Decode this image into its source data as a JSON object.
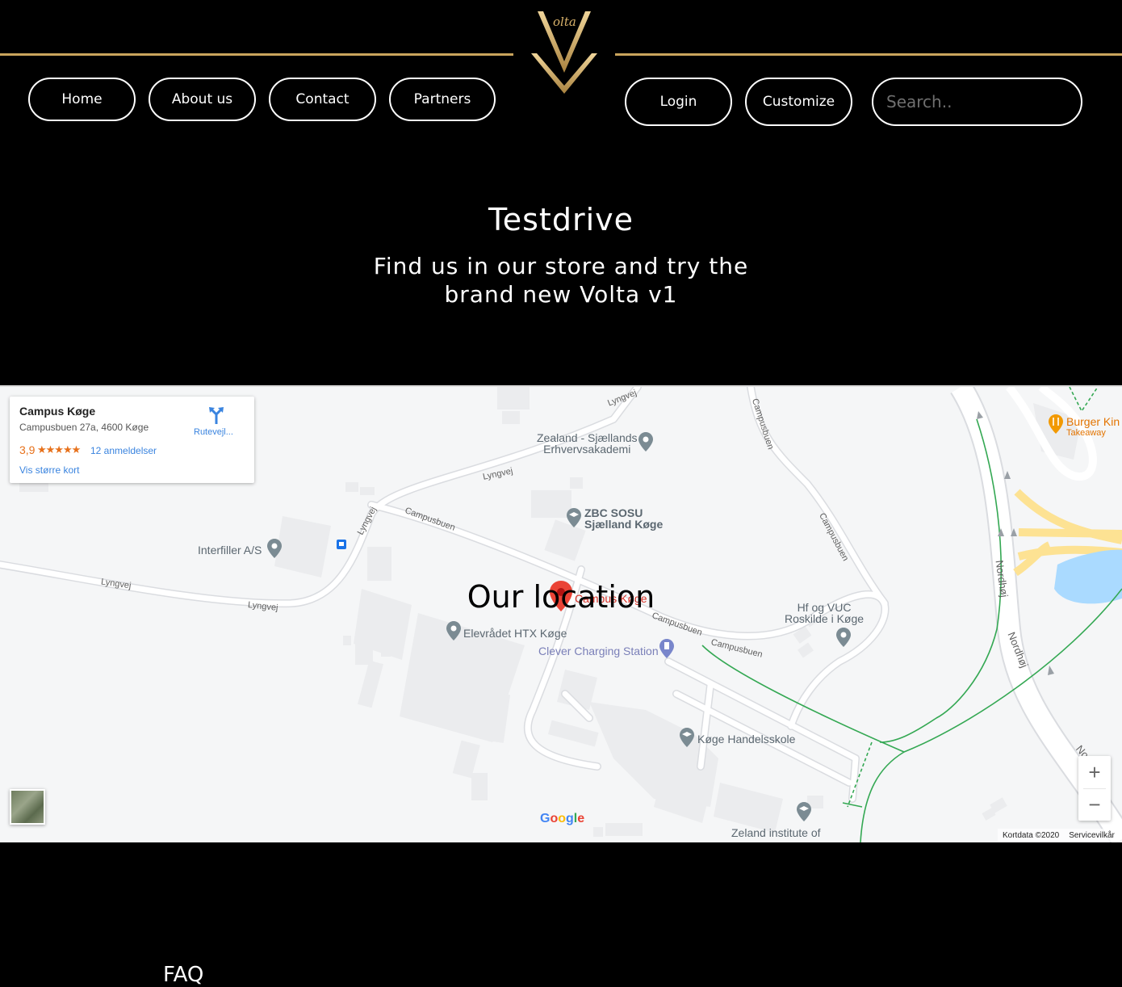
{
  "brand": {
    "logo_text": "olta"
  },
  "nav": {
    "home": "Home",
    "about": "About us",
    "contact": "Contact",
    "partners": "Partners",
    "login": "Login",
    "customize": "Customize",
    "search_placeholder": "Search.."
  },
  "hero": {
    "title": "Testdrive",
    "subtitle": "Find us in our store and try the brand new Volta v1"
  },
  "map": {
    "overlay_title": "Our location",
    "place": {
      "name": "Campus Køge",
      "address": "Campusbuen 27a, 4600 Køge",
      "rating": "3,9",
      "stars": "★★★★★",
      "reviews": "12 anmeldelser",
      "larger_map": "Vis større kort",
      "directions": "Rutevejl..."
    },
    "pin_label": "Campus Køge",
    "pois": {
      "zealand": "Zealand - Sjællands\nErhvervsakademi",
      "zbc": "ZBC SOSU\nSjælland Køge",
      "interfiller": "Interfiller A/S",
      "elevraadet": "Elevrådet HTX Køge",
      "clever": "Clever Charging Station",
      "hf": "Hf og VUC\nRoskilde i Køge",
      "handelsskole": "Køge Handelsskole",
      "zeland_inst": "Zeland institute of",
      "burger": "Burger Kin",
      "burger_sub": "Takeaway"
    },
    "roads": {
      "lyngvej": "Lyngvej",
      "campusbuen": "Campusbuen",
      "nordhoj": "Nordhøj",
      "nor": "Nor"
    },
    "zoom_in": "+",
    "zoom_out": "−",
    "google": "Google",
    "kortdata": "Kortdata ©2020",
    "terms": "Servicevilkår"
  },
  "footer": {
    "faq": "FAQ"
  },
  "colors": {
    "gold": "#c9a45c",
    "map_bg": "#f5f6f7",
    "link_blue": "#3a84df",
    "rating_orange": "#e7711b",
    "pin_red": "#d93025"
  }
}
